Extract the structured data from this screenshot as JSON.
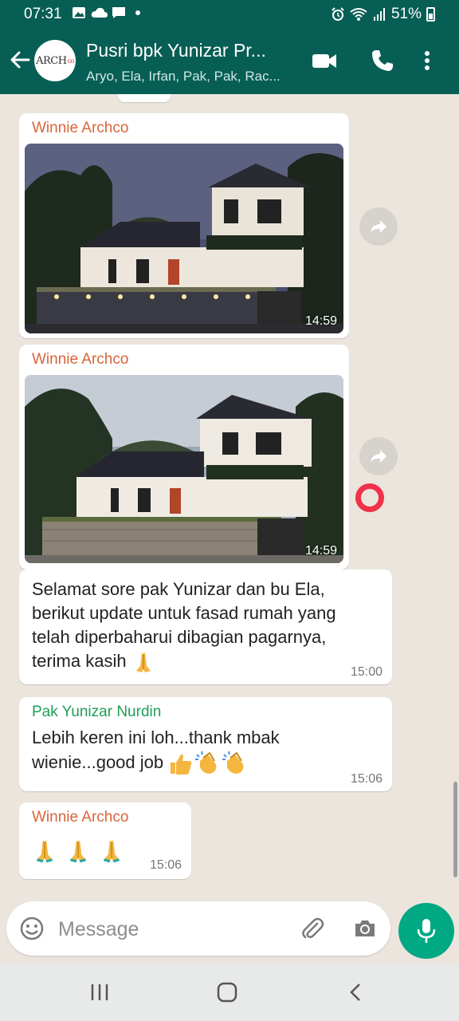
{
  "status_bar": {
    "time": "07:31",
    "battery": "51%",
    "icons": [
      "gallery-icon",
      "cloud-icon",
      "message-icon",
      "dot-icon",
      "alarm-icon",
      "wifi-icon",
      "signal-icon",
      "battery-icon"
    ]
  },
  "header": {
    "avatar_text": "ARCH",
    "avatar_sub": "co",
    "title": "Pusri bpk Yunizar Pr...",
    "subtitle": "Aryo, Ela, Irfan, Pak, Pak, Rac...",
    "icons": [
      "back-arrow-icon",
      "video-call-icon",
      "phone-icon",
      "more-vert-icon"
    ]
  },
  "messages": [
    {
      "type": "image",
      "sender": "Winnie Archco",
      "time": "14:59",
      "image": "house-render-icon"
    },
    {
      "type": "image",
      "sender": "Winnie Archco",
      "time": "14:59",
      "image": "house-render-icon"
    },
    {
      "type": "text",
      "sender": "",
      "lines": [
        "Selamat sore pak Yunizar dan bu Ela,",
        "berikut update untuk fasad rumah yang",
        "telah diperbaharui dibagian pagarnya,",
        "terima kasih"
      ],
      "emoji": "folded-hands-icon",
      "time": "15:00"
    },
    {
      "type": "text",
      "sender": "Pak Yunizar Nurdin",
      "lines": [
        "Lebih keren ini loh...thank mbak",
        "wienie...good job"
      ],
      "emoji": [
        "thumbs-up-icon",
        "clapping-hands-icon",
        "clapping-hands-icon"
      ],
      "time": "15:06"
    },
    {
      "type": "emoji",
      "sender": "Winnie Archco",
      "emoji": [
        "folded-hands-icon",
        "folded-hands-icon",
        "folded-hands-icon"
      ],
      "time": "15:06"
    }
  ],
  "composer": {
    "placeholder": "Message",
    "icons": [
      "emoji-icon",
      "attach-icon",
      "camera-icon",
      "mic-icon"
    ]
  },
  "nav": {
    "icons": [
      "recents-icon",
      "home-icon",
      "back-icon"
    ]
  },
  "colors": {
    "header": "#075e54",
    "chat_bg": "#ece5dd",
    "mic": "#00a884",
    "sender_orange": "#d9653b",
    "sender_green": "#1f9e57"
  }
}
